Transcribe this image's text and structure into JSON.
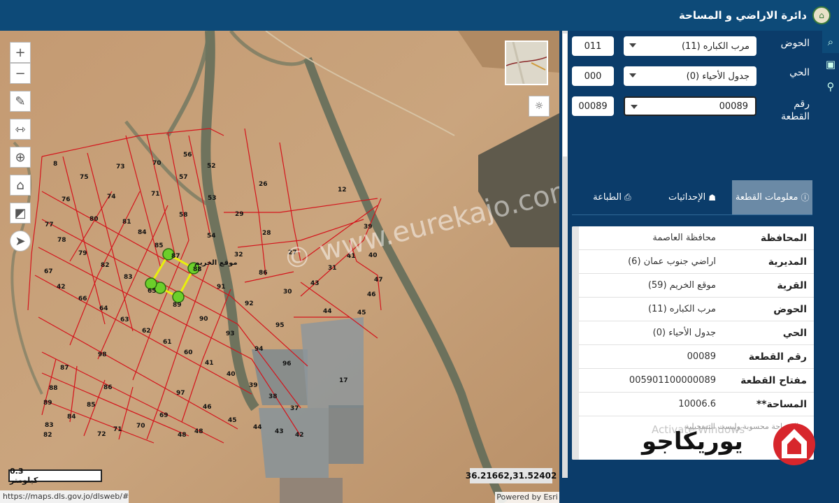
{
  "header": {
    "title": "دائرة الاراضي و المساحة"
  },
  "map": {
    "tools": [
      "zoom-in-icon",
      "zoom-out-icon",
      "pencil-icon",
      "ruler-icon",
      "locate-icon",
      "home-icon",
      "measure-area-icon",
      "compass-icon"
    ],
    "zoom_in": "+",
    "zoom_out": "−",
    "scale": "0.3 كيلومتر",
    "coordinates": "36.21662,31.52402",
    "url": "https://maps.dls.gov.jo/dlsweb/#",
    "attribution": "Powered by Esri",
    "watermark": "© www.eurekajo.com",
    "site_label": "موقع الخريم",
    "parcel_labels": [
      "8",
      "75",
      "73",
      "70",
      "56",
      "52",
      "26",
      "12",
      "76",
      "74",
      "71",
      "57",
      "53",
      "77",
      "80",
      "81",
      "58",
      "29",
      "39",
      "78",
      "84",
      "85",
      "54",
      "28",
      "79",
      "82",
      "87",
      "88",
      "32",
      "27",
      "41",
      "40",
      "67",
      "83",
      "86",
      "31",
      "42",
      "66",
      "65",
      "89",
      "91",
      "30",
      "43",
      "47",
      "46",
      "64",
      "63",
      "90",
      "92",
      "44",
      "45",
      "62",
      "61",
      "93",
      "95",
      "98",
      "60",
      "94",
      "41",
      "96",
      "87",
      "40",
      "39",
      "17",
      "88",
      "86",
      "97",
      "38",
      "89",
      "85",
      "46",
      "37",
      "84",
      "69",
      "45",
      "83",
      "82",
      "72",
      "71",
      "70",
      "48",
      "48",
      "44",
      "43",
      "42"
    ]
  },
  "form": {
    "hawd_label": "الحوض",
    "hawd_code": "011",
    "hawd_value": "مرب الكباره (11)",
    "hay_label": "الحي",
    "hay_code": "000",
    "hay_value": "جدول الأحياء (0)",
    "parcel_label": "رقم القطعة",
    "parcel_code": "00089",
    "parcel_value": "00089"
  },
  "tabs": {
    "info": "معلومات القطعة",
    "coords": "الإحداثيات",
    "print": "الطباعة"
  },
  "info": {
    "rows": [
      {
        "k": "المحافظة",
        "v": "محافظة العاصمة"
      },
      {
        "k": "المديرية",
        "v": "اراضي جنوب عمان (6)"
      },
      {
        "k": "القرية",
        "v": "موقع الخريم (59)"
      },
      {
        "k": "الحوض",
        "v": "مرب الكباره (11)"
      },
      {
        "k": "الحي",
        "v": "جدول الأحياء (0)"
      },
      {
        "k": "رقم القطعة",
        "v": "00089"
      },
      {
        "k": "مفتاح القطعة",
        "v": "005901100000089"
      },
      {
        "k": "**المساحة",
        "v": "10006.6"
      }
    ],
    "note": "المساحة محسوبة وليست التسجيلية",
    "activate": "Activate Windows"
  },
  "brand": {
    "text": "يوريكاجو"
  },
  "colors": {
    "header": "#0d4a78",
    "panel": "#0b3c6a",
    "parcel_lines": "#d4141c",
    "highlight": "#e8f00c"
  }
}
